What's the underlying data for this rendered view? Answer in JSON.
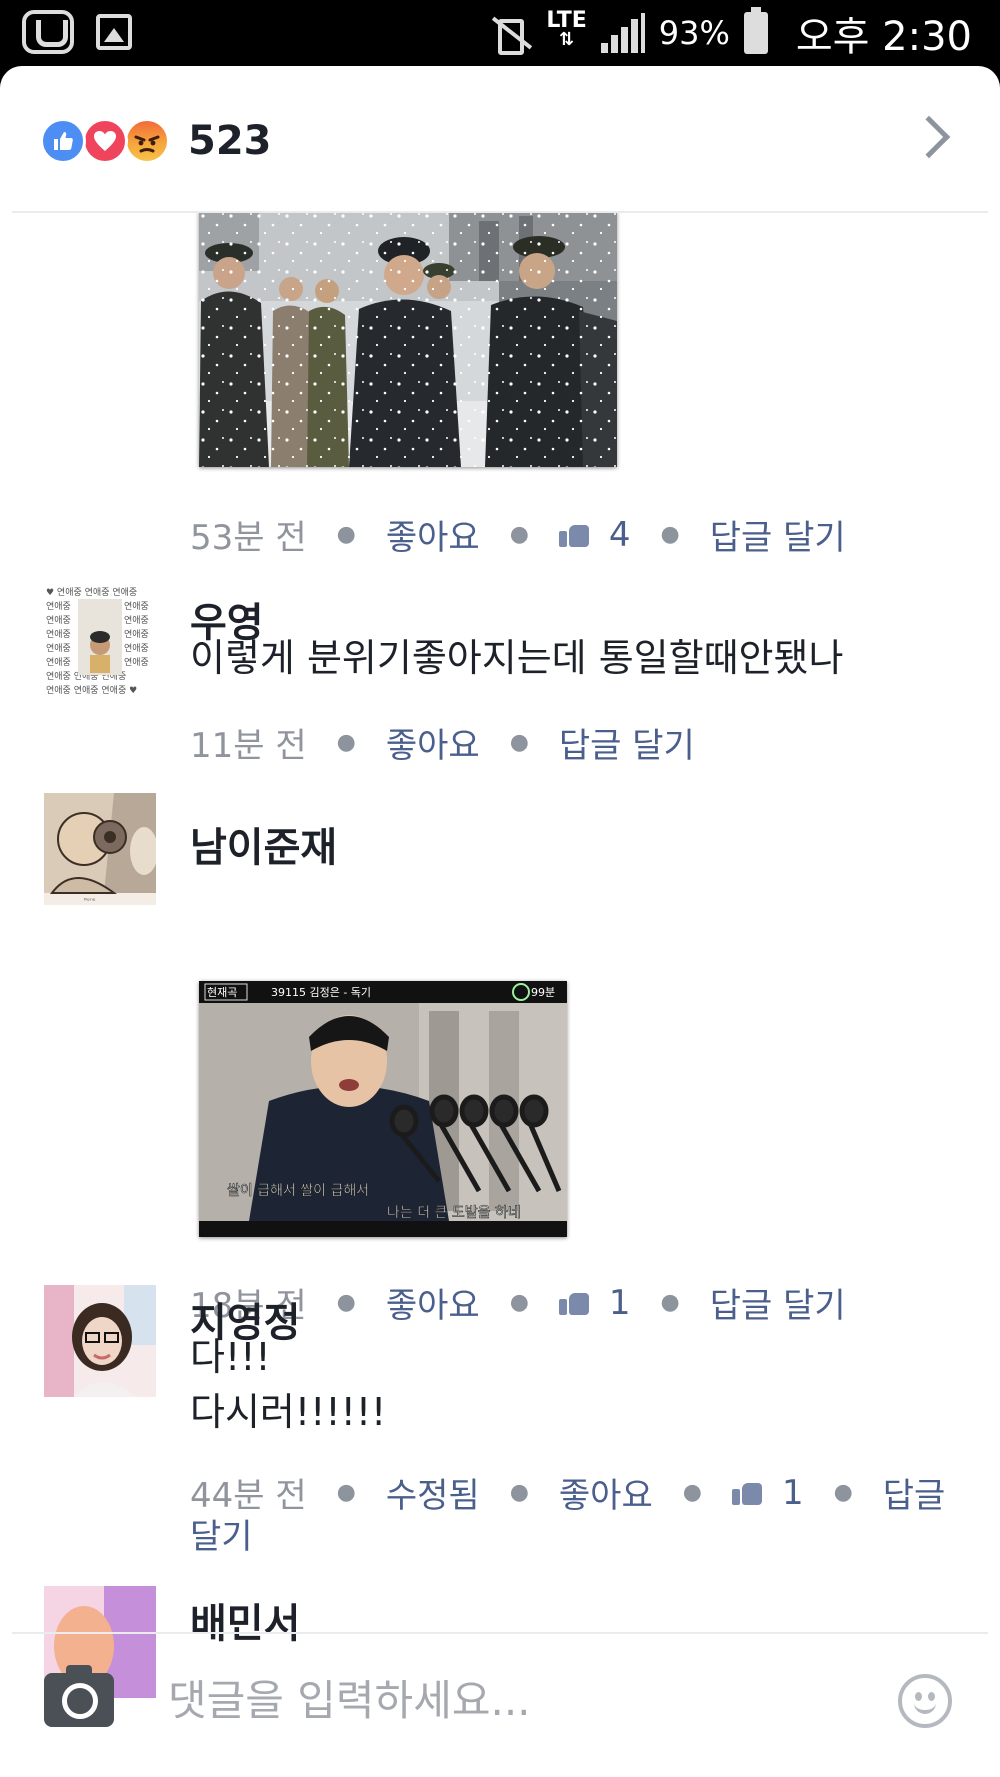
{
  "status_bar": {
    "network": "LTE",
    "battery": "93%",
    "time": "오후 2:30"
  },
  "header": {
    "reaction_count": "523",
    "reactions": [
      "like-icon",
      "love-icon",
      "angry-icon"
    ]
  },
  "comments": [
    {
      "image": {
        "alt": "snow-photo-generals"
      },
      "time": "53분 전",
      "like_label": "좋아요",
      "likes": "4",
      "reply_label": "답글 달기"
    },
    {
      "name": "우영",
      "text": "이렇게 분위기좋아지는데 통일할때안됐나",
      "time": "11분 전",
      "like_label": "좋아요",
      "reply_label": "답글 달기"
    },
    {
      "name": "남이준재",
      "image": {
        "caption_left": "현재곡",
        "caption_title": "39115 김정은 - 독기",
        "caption_time": "99분",
        "lyric1": "쌀이 급해서 쌀이 급해서",
        "lyric2": "나는 더 큰 도발을 하네"
      },
      "time": "18분 전",
      "like_label": "좋아요",
      "likes": "1",
      "reply_label": "답글 달기"
    },
    {
      "name": "지영정",
      "lines": [
        "다!!!",
        "다시러!!!!!!"
      ],
      "time": "44분 전",
      "edited_label": "수정됨",
      "like_label": "좋아요",
      "likes": "1",
      "reply_label_part1": "답글",
      "reply_label_part2": "달기"
    },
    {
      "name": "배민서"
    }
  ],
  "composer": {
    "placeholder": "댓글을 입력하세요..."
  }
}
